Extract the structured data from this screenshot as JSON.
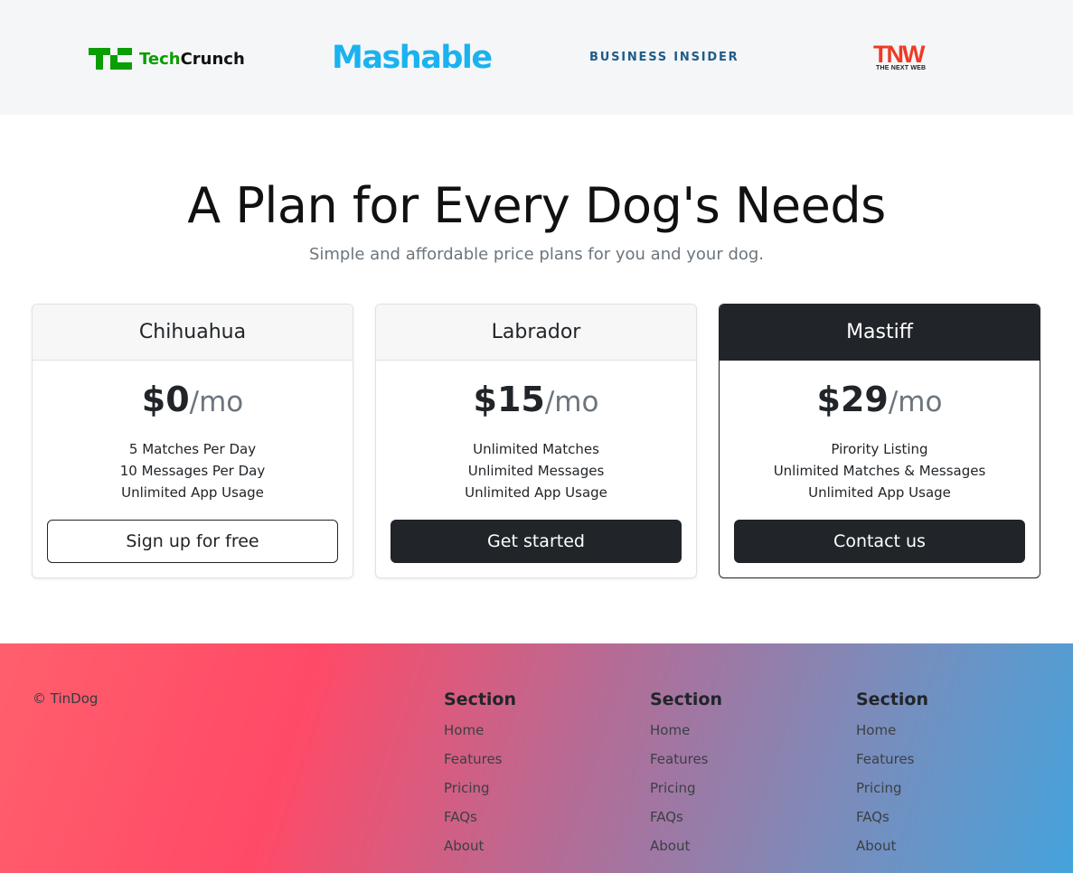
{
  "press_logos": {
    "techcrunch": {
      "mark": "TC",
      "word_prefix": "Tech",
      "word_suffix": "Crunch"
    },
    "mashable": "Mashable",
    "business_insider": "BUSINESS INSIDER",
    "tnw": {
      "letters": "TNW",
      "sub": "THE NEXT WEB"
    }
  },
  "pricing": {
    "title": "A Plan for Every Dog's Needs",
    "subtitle": "Simple and affordable price plans for you and your dog.",
    "plans": [
      {
        "name": "Chihuahua",
        "price": "$0",
        "period": "/mo",
        "features": [
          "5 Matches Per Day",
          "10 Messages Per Day",
          "Unlimited App Usage"
        ],
        "cta": "Sign up for free"
      },
      {
        "name": "Labrador",
        "price": "$15",
        "period": "/mo",
        "features": [
          "Unlimited Matches",
          "Unlimited Messages",
          "Unlimited App Usage"
        ],
        "cta": "Get started"
      },
      {
        "name": "Mastiff",
        "price": "$29",
        "period": "/mo",
        "features": [
          "Pirority Listing",
          "Unlimited Matches & Messages",
          "Unlimited App Usage"
        ],
        "cta": "Contact us"
      }
    ]
  },
  "footer": {
    "copyright": "© TinDog",
    "columns": [
      {
        "heading": "Section",
        "links": [
          "Home",
          "Features",
          "Pricing",
          "FAQs",
          "About"
        ]
      },
      {
        "heading": "Section",
        "links": [
          "Home",
          "Features",
          "Pricing",
          "FAQs",
          "About"
        ]
      },
      {
        "heading": "Section",
        "links": [
          "Home",
          "Features",
          "Pricing",
          "FAQs",
          "About"
        ]
      }
    ]
  },
  "colors": {
    "techcrunch_green": "#0a9e01",
    "mashable_blue": "#1ab2f0",
    "business_insider_blue": "#1f5c87",
    "tnw_red": "#ee3a24",
    "dark": "#212529",
    "footer_gradient": [
      "#ff5f6d",
      "#ff4a67",
      "#b26d97",
      "#7b8cbb",
      "#45a3dc"
    ]
  }
}
